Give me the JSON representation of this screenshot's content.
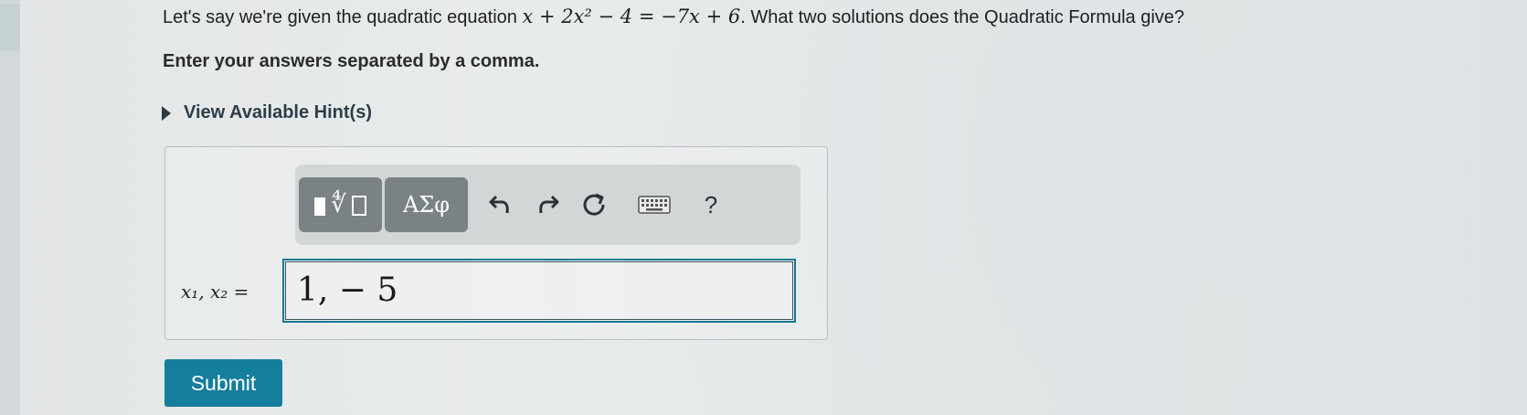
{
  "question": {
    "prefix": "Let's say we're given the quadratic equation ",
    "equation": "x + 2x² − 4 = −7x + 6",
    "suffix": ". What two solutions does the Quadratic Formula give?"
  },
  "instruction": "Enter your answers separated by a comma.",
  "hint": {
    "label": "View Available Hint(s)"
  },
  "toolbar": {
    "greek_label": "ΑΣφ",
    "help_label": "?"
  },
  "answer": {
    "variable_label": "x₁, x₂ =",
    "value": "1, − 5"
  },
  "submit_label": "Submit",
  "colors": {
    "accent": "#157e9c",
    "toolbar_button": "#7b8285"
  }
}
